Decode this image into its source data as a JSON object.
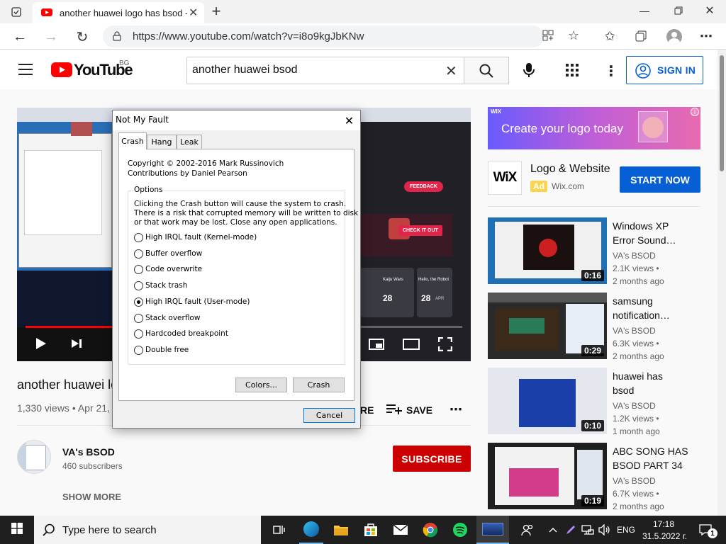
{
  "browser": {
    "tab_title": "another huawei logo has bsod -",
    "url": "https://www.youtube.com/watch?v=i8o9kgJbKNw"
  },
  "youtube": {
    "logo_text": "YouTube",
    "region": "BG",
    "search_value": "another huawei bsod",
    "sign_in": "SIGN IN",
    "video": {
      "title": "another huawei lo",
      "stats": "1,330 views • Apr 21,",
      "share_partial": "RE",
      "save": "SAVE",
      "channel": "VA's BSOD",
      "subscribers": "460 subscribers",
      "subscribe": "SUBSCRIBE",
      "show_more": "SHOW MORE"
    },
    "ad": {
      "banner_brand": "WIX",
      "banner_text": "Create your logo today",
      "logo_text": "WiX",
      "title": "Logo & Website",
      "badge": "Ad",
      "domain": "Wix.com",
      "cta": "START NOW"
    },
    "recommendations": [
      {
        "title_lines": [
          "Windows XP",
          "Error Sound…"
        ],
        "channel": "VA's BSOD",
        "views": "2.1K views •",
        "age": "2 months ago",
        "duration": "0:16"
      },
      {
        "title_lines": [
          "samsung",
          "notification…"
        ],
        "channel": "VA's BSOD",
        "views": "6.3K views •",
        "age": "2 months ago",
        "duration": "0:29"
      },
      {
        "title_lines": [
          "huawei has",
          "bsod"
        ],
        "channel": "VA's BSOD",
        "views": "1.2K views •",
        "age": "1 month ago",
        "duration": "0:10"
      },
      {
        "title_lines": [
          "ABC SONG HAS",
          "BSOD PART 34"
        ],
        "channel": "VA's BSOD",
        "views": "6.7K views •",
        "age": "2 months ago",
        "duration": "0:19"
      }
    ]
  },
  "dialog": {
    "title": "Not My Fault",
    "tabs": [
      "Crash",
      "Hang",
      "Leak"
    ],
    "copyright": "Copyright © 2002-2016 Mark Russinovich",
    "contributions": "Contributions by Daniel Pearson",
    "options_label": "Options",
    "description_lines": [
      "Clicking the Crash button will cause the system to crash.",
      "There is a risk that corrupted memory will be written to disk",
      "or that work may be lost. Close any open applications."
    ],
    "options": [
      {
        "label": "High IRQL fault (Kernel-mode)",
        "selected": false
      },
      {
        "label": "Buffer overflow",
        "selected": false
      },
      {
        "label": "Code overwrite",
        "selected": false
      },
      {
        "label": "Stack trash",
        "selected": false
      },
      {
        "label": "High IRQL fault (User-mode)",
        "selected": true
      },
      {
        "label": "Stack overflow",
        "selected": false
      },
      {
        "label": "Hardcoded breakpoint",
        "selected": false
      },
      {
        "label": "Double free",
        "selected": false
      }
    ],
    "colors_button": "Colors...",
    "crash_button": "Crash",
    "cancel_button": "Cancel"
  },
  "player_content": {
    "feedback": "FEEDBACK",
    "check_it_out": "CHECK IT OUT",
    "card1": "Kaiju Wars",
    "card2": "Hello, the Robot",
    "num1": "28",
    "num2": "28",
    "apr": "APR"
  },
  "taskbar": {
    "search_placeholder": "Type here to search",
    "language": "ENG",
    "time": "17:18",
    "date": "31.5.2022 г.",
    "notification_count": "1"
  }
}
